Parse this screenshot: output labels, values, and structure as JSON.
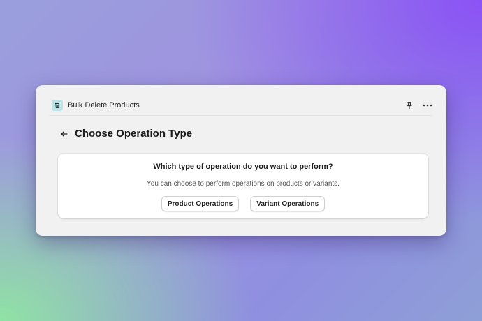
{
  "window": {
    "app_title": "Bulk Delete Products",
    "app_icon": "trash-icon",
    "actions": [
      "pin-icon",
      "more-icon"
    ]
  },
  "page": {
    "title": "Choose Operation Type",
    "back_icon": "arrow-left-icon"
  },
  "card": {
    "question": "Which type of operation do you want to perform?",
    "description": "You can choose to perform operations on products or variants.",
    "buttons": {
      "product": "Product Operations",
      "variant": "Variant Operations"
    }
  },
  "colors": {
    "window_bg": "#f1f1f1",
    "card_bg": "#ffffff",
    "app_icon_bg": "#bfe2e4"
  }
}
